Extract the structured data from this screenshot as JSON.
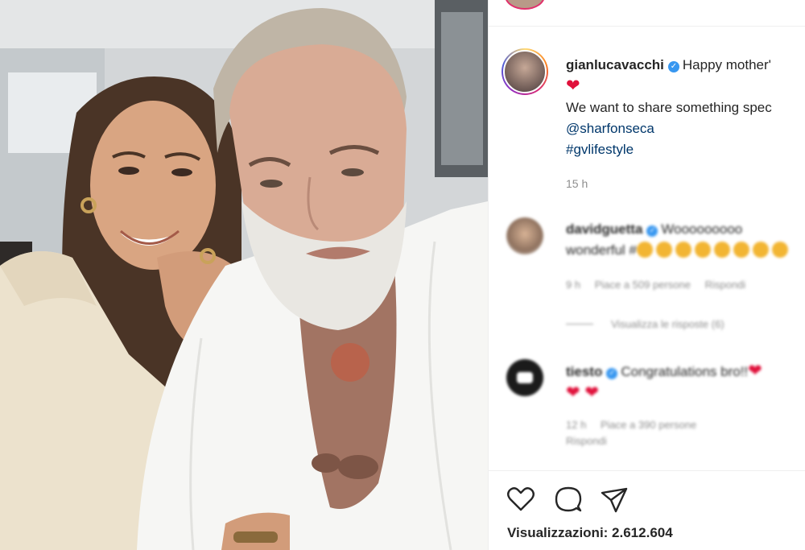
{
  "post": {
    "author": "gianlucavacchi",
    "caption_line1": "Happy mother'",
    "caption_heart": "❤",
    "caption_line2": "We want to share something spec",
    "mention": "@sharfonseca",
    "hashtag": "#gvlifestyle",
    "time": "15 h"
  },
  "comments": [
    {
      "user": "davidguetta",
      "text_line1": "Wooooooooo",
      "text_line2": "wonderful #",
      "time": "9 h",
      "likes": "Piace a 509 persone",
      "reply": "Rispondi",
      "view_replies": "Visualizza le risposte (6)"
    },
    {
      "user": "tiesto",
      "text_line1": "Congratulations bro!!",
      "heart_line1": "❤",
      "hearts_line2": "❤ ❤",
      "time": "12 h",
      "likes": "Piace a 390 persone",
      "reply": "Rispondi"
    }
  ],
  "actions": {
    "like_icon": "heart-outline-icon",
    "comment_icon": "comment-bubble-icon",
    "share_icon": "paper-plane-icon"
  },
  "views": "Visualizzazioni: 2.612.604",
  "colors": {
    "verified": "#3897f0",
    "link": "#00376b",
    "muted": "#8e8e8e",
    "heart": "#e0113b"
  }
}
